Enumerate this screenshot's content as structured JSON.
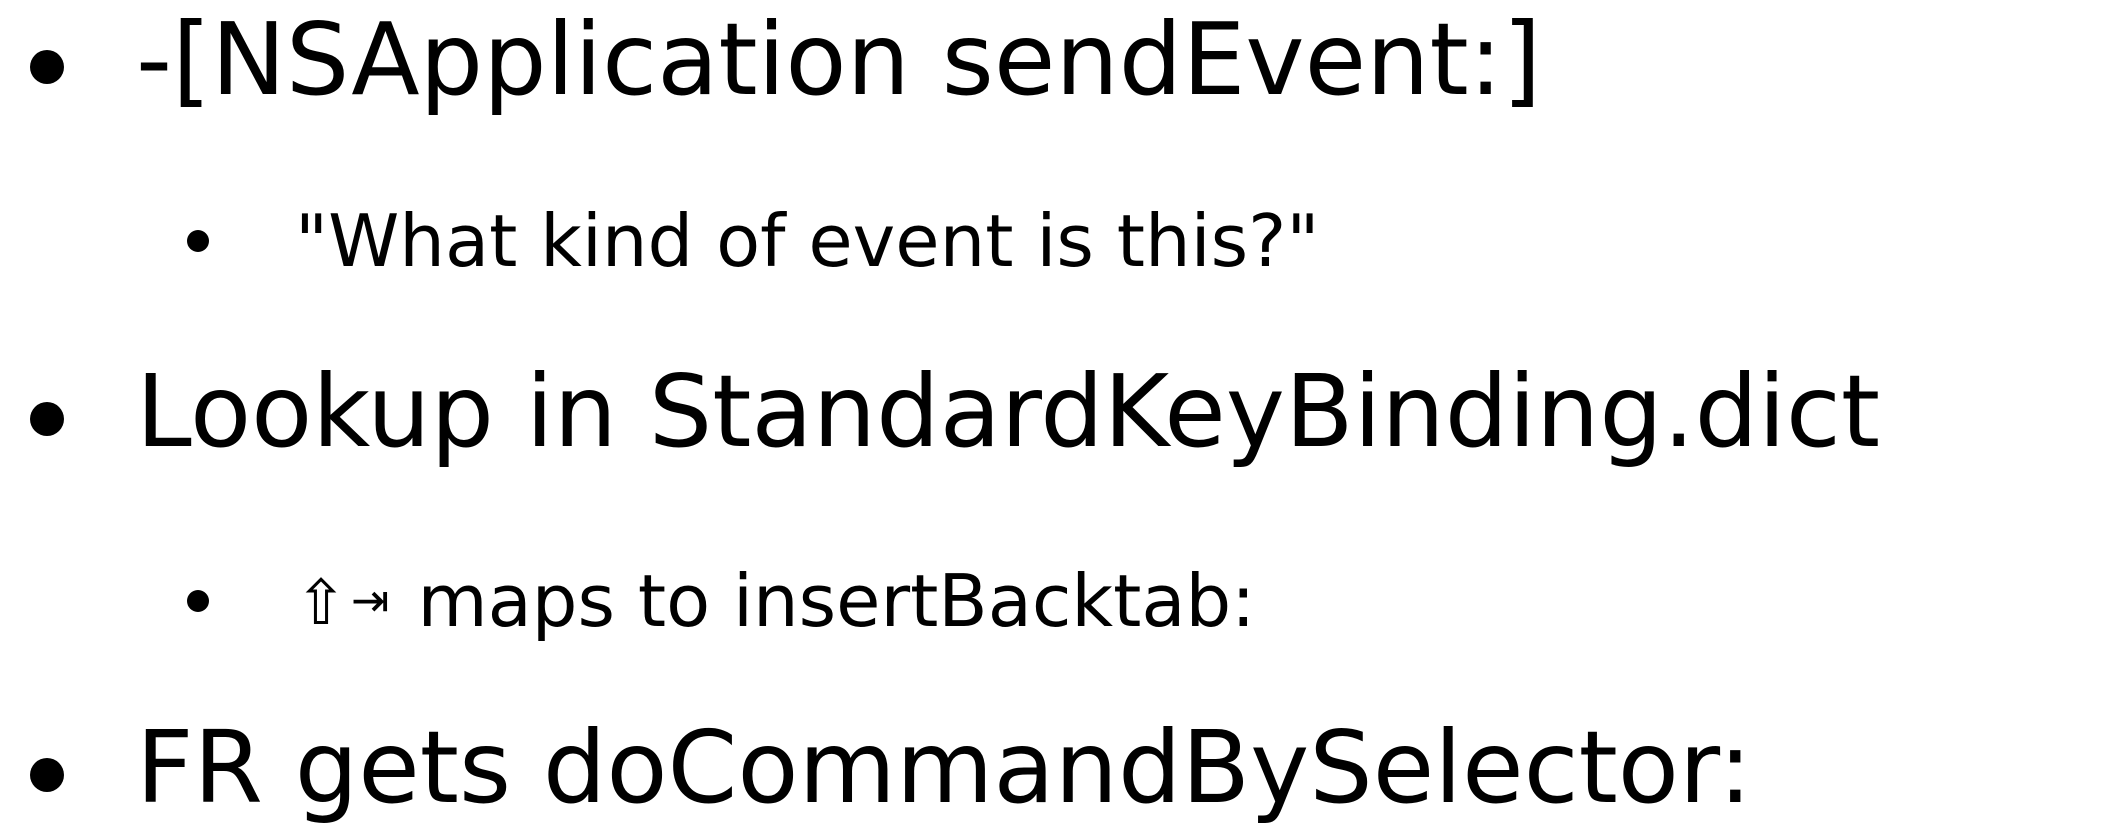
{
  "slide": {
    "items": [
      {
        "level": 1,
        "text": "-[NSApplication sendEvent:]"
      },
      {
        "level": 2,
        "text": "\"What kind of event is this?\""
      },
      {
        "level": 1,
        "text": "Lookup in StandardKeyBinding.dict"
      },
      {
        "level": 2,
        "keys": {
          "shift": "⇧",
          "tab": "⇥"
        },
        "text": "maps to insertBacktab:"
      },
      {
        "level": 1,
        "text": "FR gets doCommandBySelector:"
      }
    ]
  },
  "icons": {
    "bullet": "bullet-dot",
    "shift": "shift-key-icon",
    "tab": "tab-key-icon"
  },
  "colors": {
    "background": "#ffffff",
    "text": "#000000"
  }
}
